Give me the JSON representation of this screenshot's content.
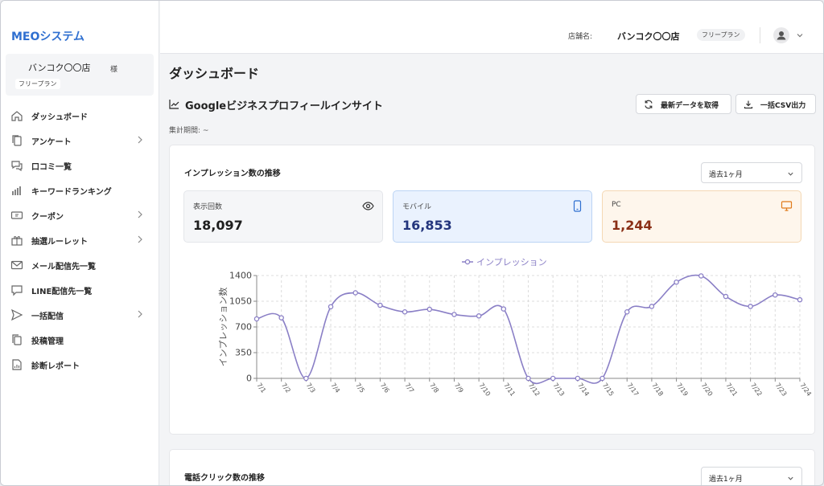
{
  "sidebar": {
    "brand": "MEOシステム",
    "store_name": "バンコク〇〇店",
    "store_suffix": "様",
    "plan": "フリープラン",
    "items": [
      {
        "label": "ダッシュボード",
        "icon": "home-icon",
        "chevron": false
      },
      {
        "label": "アンケート",
        "icon": "documents-icon",
        "chevron": true
      },
      {
        "label": "口コミ一覧",
        "icon": "chat-bubbles-icon",
        "chevron": false
      },
      {
        "label": "キーワードランキング",
        "icon": "bar-chart-icon",
        "chevron": false
      },
      {
        "label": "クーポン",
        "icon": "ticket-icon",
        "chevron": true
      },
      {
        "label": "抽選ルーレット",
        "icon": "gift-icon",
        "chevron": true
      },
      {
        "label": "メール配信先一覧",
        "icon": "envelope-icon",
        "chevron": false
      },
      {
        "label": "LINE配信先一覧",
        "icon": "speech-bubble-icon",
        "chevron": false
      },
      {
        "label": "一括配信",
        "icon": "send-icon",
        "chevron": true
      },
      {
        "label": "投稿管理",
        "icon": "copy-icon",
        "chevron": false
      },
      {
        "label": "診断レポート",
        "icon": "report-icon",
        "chevron": false
      }
    ]
  },
  "header": {
    "store_label": "店舗名:",
    "store_name": "バンコク〇〇店",
    "plan": "フリープラン"
  },
  "main": {
    "page_title": "ダッシュボード",
    "section_title": "Googleビジネスプロフィールインサイト",
    "refresh_button": "最新データを取得",
    "export_button": "一括CSV出力",
    "period_label": "集計期間: ~"
  },
  "impressions_card": {
    "title": "インプレッション数の推移",
    "range_select": "過去1ヶ月",
    "stats": [
      {
        "label": "表示回数",
        "value": "18,097",
        "icon": "eye-icon"
      },
      {
        "label": "モバイル",
        "value": "16,853",
        "icon": "mobile-icon"
      },
      {
        "label": "PC",
        "value": "1,244",
        "icon": "monitor-icon"
      }
    ]
  },
  "calls_card": {
    "title": "電話クリック数の推移",
    "range_select": "過去1ヶ月"
  },
  "chart_data": {
    "type": "line",
    "title": "",
    "legend": "インプレッション",
    "legend_position": "top-center",
    "ylabel": "インプレッション数",
    "xlabel": "",
    "ylim": [
      0,
      1400
    ],
    "yticks": [
      0,
      350,
      700,
      1050,
      1400
    ],
    "grid": true,
    "color": "#8a7fc6",
    "categories": [
      "7/1",
      "7/2",
      "7/3",
      "7/4",
      "7/5",
      "7/6",
      "7/7",
      "7/8",
      "7/9",
      "7/10",
      "7/11",
      "7/12",
      "7/13",
      "7/14",
      "7/15",
      "7/17",
      "7/18",
      "7/19",
      "7/20",
      "7/21",
      "7/22",
      "7/23",
      "7/24"
    ],
    "series": [
      {
        "name": "インプレッション",
        "values": [
          810,
          825,
          0,
          975,
          1165,
          995,
          905,
          940,
          870,
          850,
          945,
          0,
          0,
          0,
          0,
          905,
          980,
          1310,
          1395,
          1115,
          980,
          1135,
          1070
        ]
      }
    ]
  }
}
